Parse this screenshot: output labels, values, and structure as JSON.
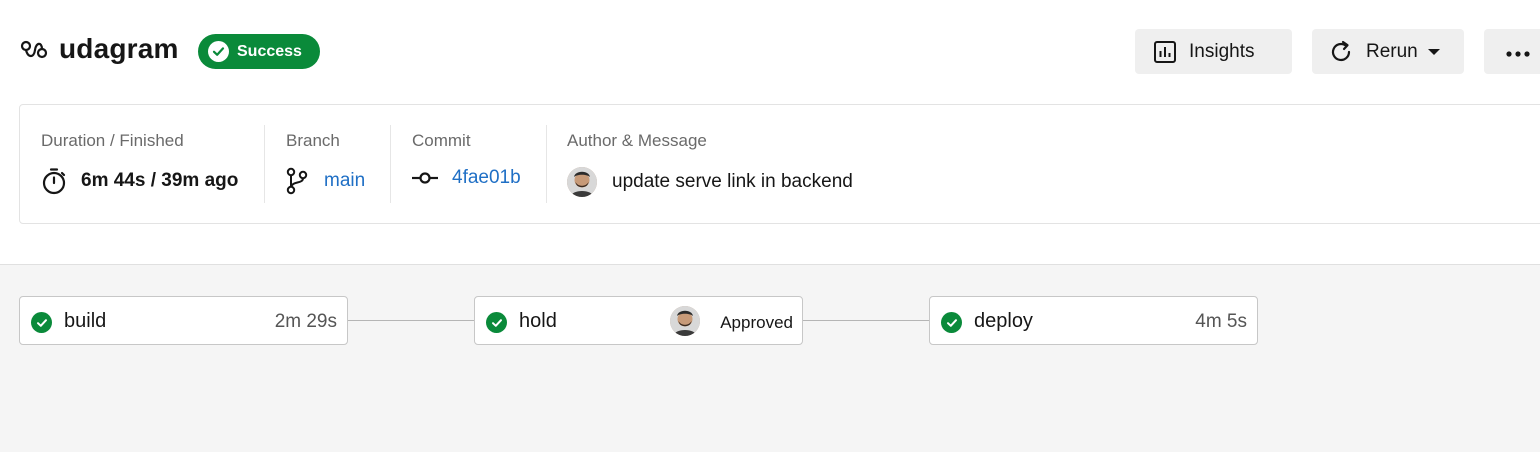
{
  "header": {
    "workflow_icon": "workflow-icon",
    "title": "udagram",
    "status": "Success",
    "status_color": "#0a8a3a",
    "actions": {
      "insights_label": "Insights",
      "rerun_label": "Rerun",
      "more_icon": "more-horizontal-icon"
    }
  },
  "info": {
    "duration": {
      "label": "Duration / Finished",
      "value": "6m 44s / 39m ago"
    },
    "branch": {
      "label": "Branch",
      "value": "main"
    },
    "commit": {
      "label": "Commit",
      "value": "4fae01b"
    },
    "author": {
      "label": "Author & Message",
      "message": "update serve link in backend"
    }
  },
  "jobs": [
    {
      "name": "build",
      "time": "2m 29s",
      "status": "success"
    },
    {
      "name": "hold",
      "approval": "Approved",
      "status": "success"
    },
    {
      "name": "deploy",
      "time": "4m 5s",
      "status": "success"
    }
  ],
  "colors": {
    "success": "#0a8a3a",
    "link": "#1f6fc5"
  }
}
